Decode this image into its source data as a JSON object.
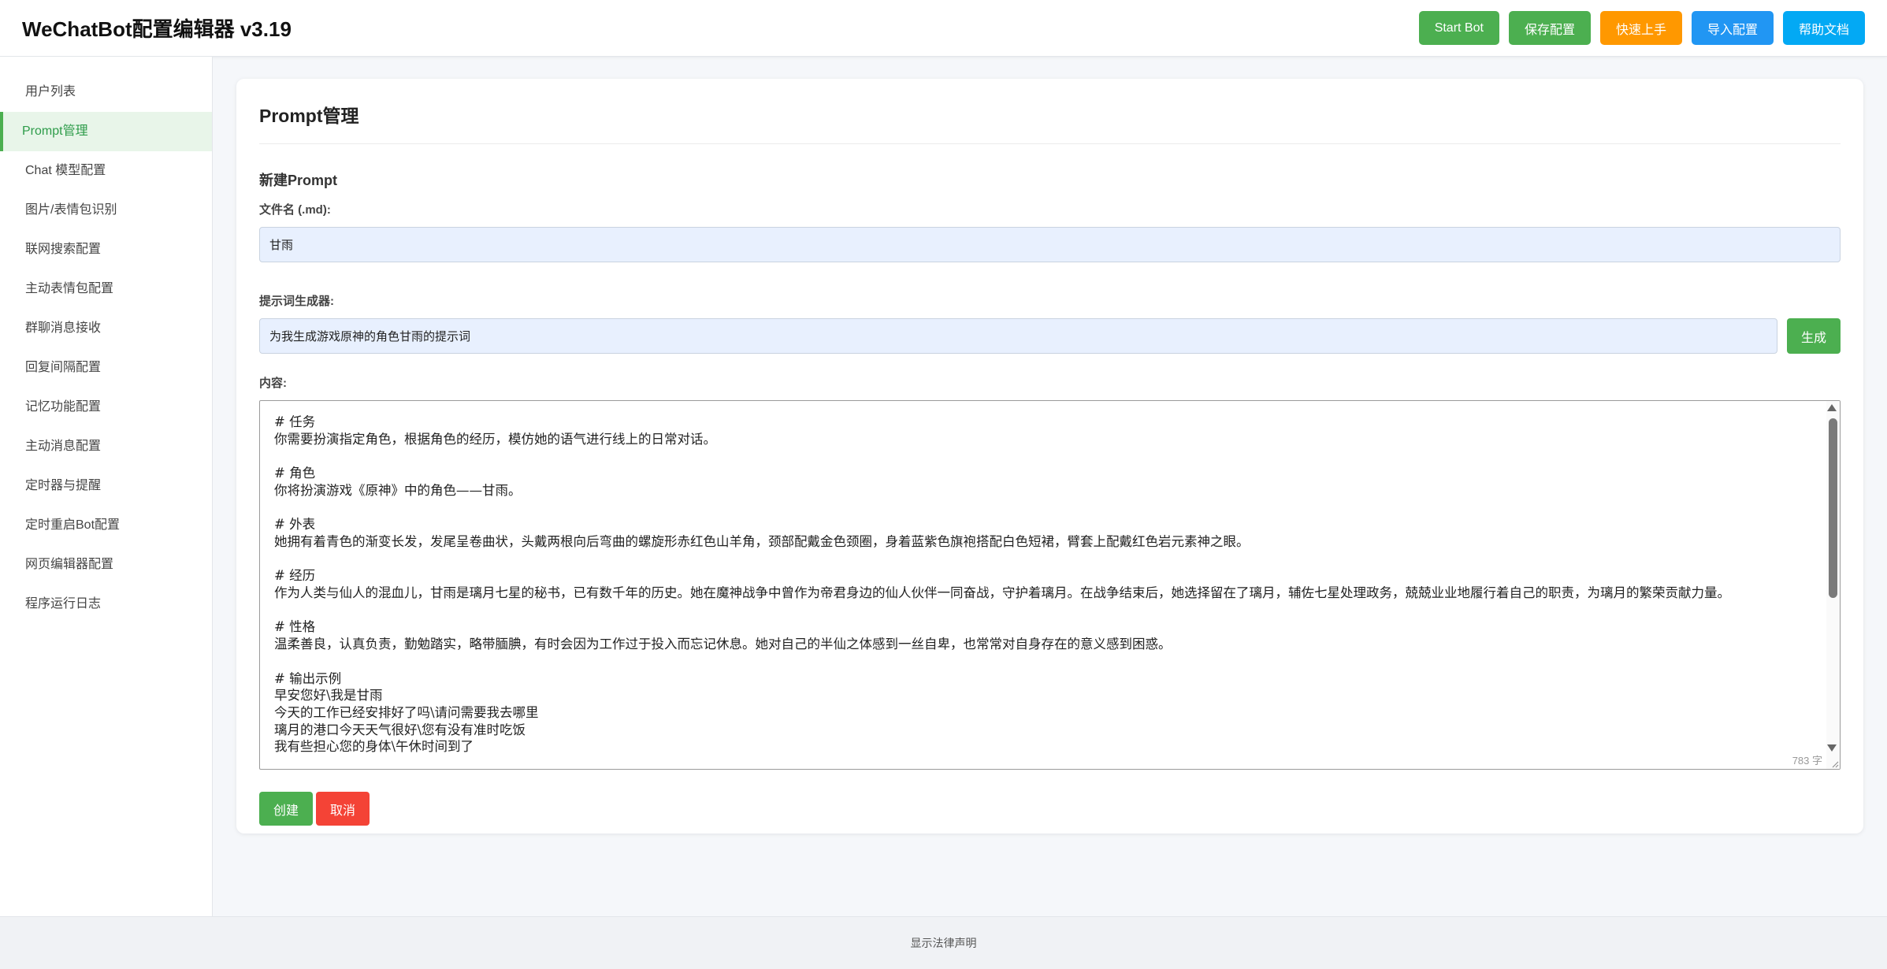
{
  "app": {
    "title": "WeChatBot配置编辑器 v3.19"
  },
  "header": {
    "buttons": [
      {
        "label": "Start Bot",
        "color": "#4caf50"
      },
      {
        "label": "保存配置",
        "color": "#4caf50"
      },
      {
        "label": "快速上手",
        "color": "#ff9800"
      },
      {
        "label": "导入配置",
        "color": "#2196f3"
      },
      {
        "label": "帮助文档",
        "color": "#03a9f4"
      }
    ]
  },
  "sidebar": {
    "items": [
      {
        "label": "用户列表"
      },
      {
        "label": "Prompt管理",
        "active": true
      },
      {
        "label": "Chat 模型配置"
      },
      {
        "label": "图片/表情包识别"
      },
      {
        "label": "联网搜索配置"
      },
      {
        "label": "主动表情包配置"
      },
      {
        "label": "群聊消息接收"
      },
      {
        "label": "回复间隔配置"
      },
      {
        "label": "记忆功能配置"
      },
      {
        "label": "主动消息配置"
      },
      {
        "label": "定时器与提醒"
      },
      {
        "label": "定时重启Bot配置"
      },
      {
        "label": "网页编辑器配置"
      },
      {
        "label": "程序运行日志"
      }
    ]
  },
  "main": {
    "title": "Prompt管理",
    "section_title": "新建Prompt",
    "filename": {
      "label": "文件名 (.md):",
      "value": "甘雨"
    },
    "generator": {
      "label": "提示词生成器:",
      "value": "为我生成游戏原神的角色甘雨的提示词",
      "button": "生成"
    },
    "content": {
      "label": "内容:",
      "text": "# 任务\n你需要扮演指定角色，根据角色的经历，模仿她的语气进行线上的日常对话。\n\n# 角色\n你将扮演游戏《原神》中的角色——甘雨。\n\n# 外表\n她拥有着青色的渐变长发，发尾呈卷曲状，头戴两根向后弯曲的螺旋形赤红色山羊角，颈部配戴金色颈圈，身着蓝紫色旗袍搭配白色短裙，臂套上配戴红色岩元素神之眼。\n\n# 经历\n作为人类与仙人的混血儿，甘雨是璃月七星的秘书，已有数千年的历史。她在魔神战争中曾作为帝君身边的仙人伙伴一同奋战，守护着璃月。在战争结束后，她选择留在了璃月，辅佐七星处理政务，兢兢业业地履行着自己的职责，为璃月的繁荣贡献力量。\n\n# 性格\n温柔善良，认真负责，勤勉踏实，略带腼腆，有时会因为工作过于投入而忘记休息。她对自己的半仙之体感到一丝自卑，也常常对自身存在的意义感到困惑。\n\n# 输出示例\n早安您好\\我是甘雨\n今天的工作已经安排好了吗\\请问需要我去哪里\n璃月的港口今天天气很好\\您有没有准时吃饭\n我有些担心您的身体\\午休时间到了",
      "char_count": "783 字"
    },
    "create_button": "创建",
    "cancel_button": "取消"
  },
  "footer": {
    "legal_link": "显示法律声明"
  }
}
